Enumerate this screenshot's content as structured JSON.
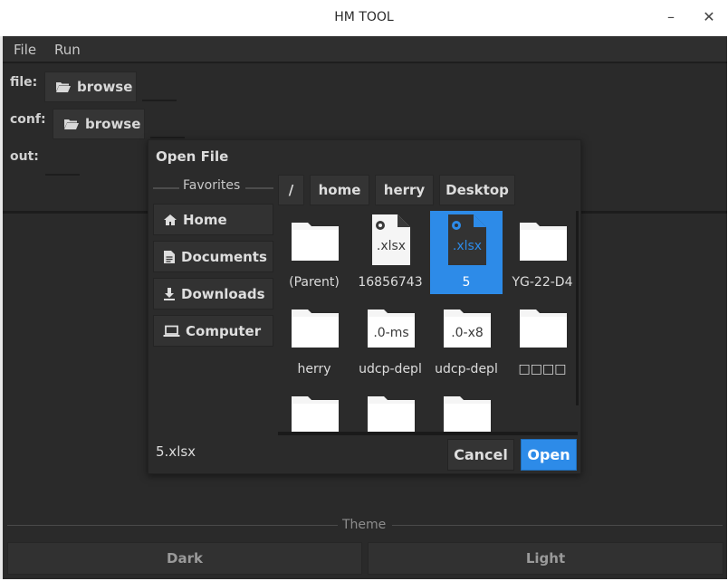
{
  "window": {
    "title": "HM TOOL",
    "minimize": "–",
    "close": "✕"
  },
  "menu": {
    "items": [
      "File",
      "Run"
    ]
  },
  "form": {
    "file_label": "file:",
    "conf_label": "conf:",
    "out_label": "out:",
    "browse_label": "browse"
  },
  "theme": {
    "label": "Theme",
    "dark": "Dark",
    "light": "Light"
  },
  "dialog": {
    "title": "Open File",
    "favorites_label": "Favorites",
    "favorites": [
      {
        "label": "Home",
        "icon": "home-icon"
      },
      {
        "label": "Documents",
        "icon": "document-icon"
      },
      {
        "label": "Downloads",
        "icon": "download-icon"
      },
      {
        "label": "Computer",
        "icon": "laptop-icon"
      }
    ],
    "breadcrumbs": [
      "/",
      "home",
      "herry",
      "Desktop"
    ],
    "files": [
      {
        "name": "(Parent)",
        "type": "folder",
        "ext": ""
      },
      {
        "name": "16856743",
        "type": "file",
        "ext": ".xlsx"
      },
      {
        "name": "5",
        "type": "file",
        "ext": ".xlsx",
        "selected": true
      },
      {
        "name": "YG-22-D4",
        "type": "folder",
        "ext": ""
      },
      {
        "name": "herry",
        "type": "folder",
        "ext": ""
      },
      {
        "name": "udcp-depl",
        "type": "plainfile",
        "ext": ".0-ms"
      },
      {
        "name": "udcp-depl",
        "type": "plainfile",
        "ext": ".0-x8"
      },
      {
        "name": "□□□□",
        "type": "folder",
        "ext": ""
      },
      {
        "name": "",
        "type": "folder",
        "ext": ""
      },
      {
        "name": "",
        "type": "folder",
        "ext": ""
      },
      {
        "name": "",
        "type": "folder",
        "ext": ""
      }
    ],
    "filename": "5.xlsx",
    "cancel_label": "Cancel",
    "open_label": "Open"
  },
  "colors": {
    "accent": "#2d8be8",
    "background": "#2a2a2a",
    "dialog": "#2b2b2b"
  }
}
